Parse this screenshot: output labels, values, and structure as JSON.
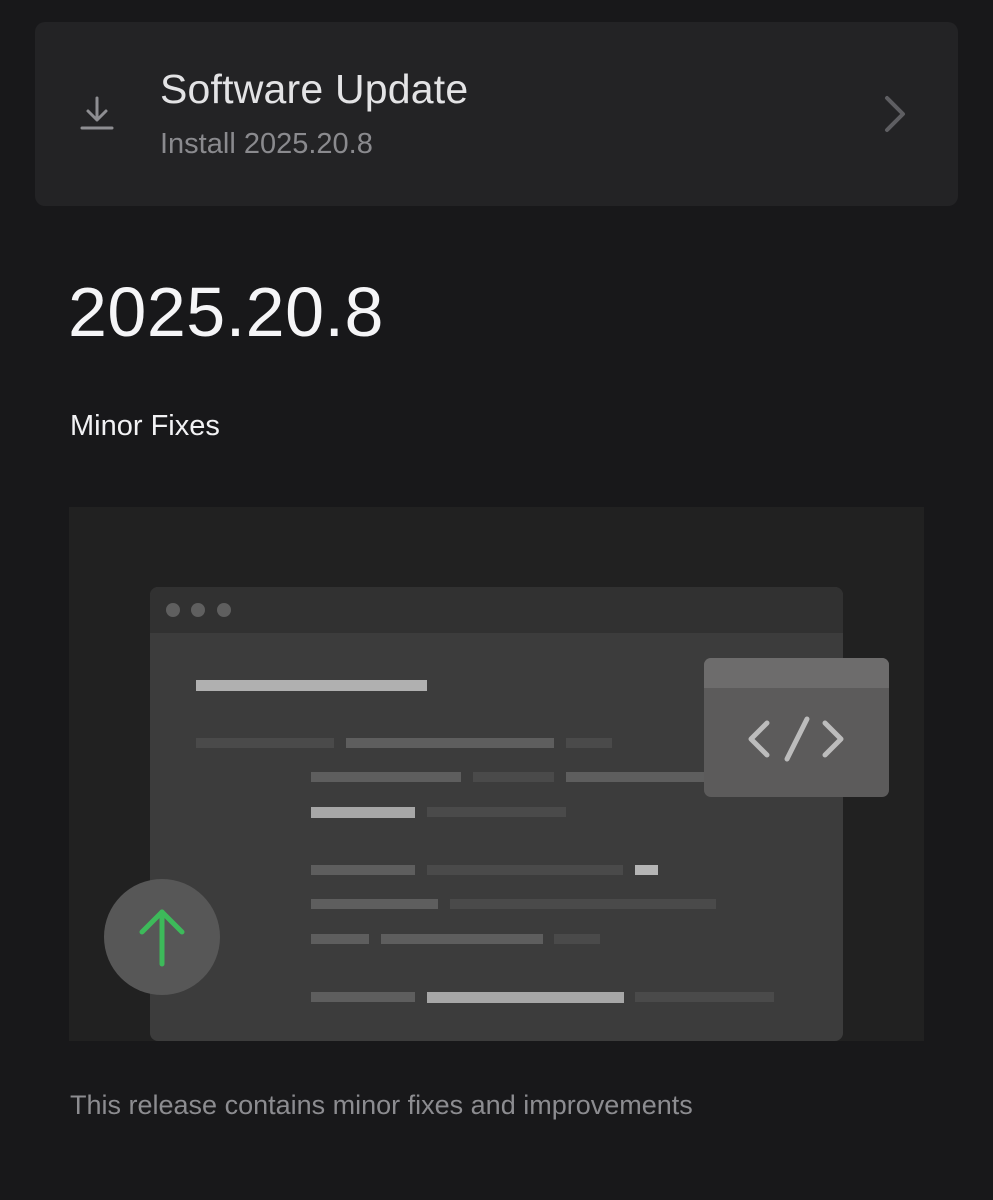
{
  "update_card": {
    "title": "Software Update",
    "subtitle": "Install 2025.20.8",
    "leading_icon": "download-icon",
    "trailing_icon": "chevron-right-icon"
  },
  "release": {
    "version": "2025.20.8",
    "label": "Minor Fixes",
    "description": "This release contains minor fixes and improvements"
  },
  "illustration": {
    "code_icon": "code-icon",
    "badge_icon": "arrow-up-icon"
  },
  "colors": {
    "background": "#18181a",
    "card": "#232325",
    "accent_green": "#3dba5a"
  }
}
